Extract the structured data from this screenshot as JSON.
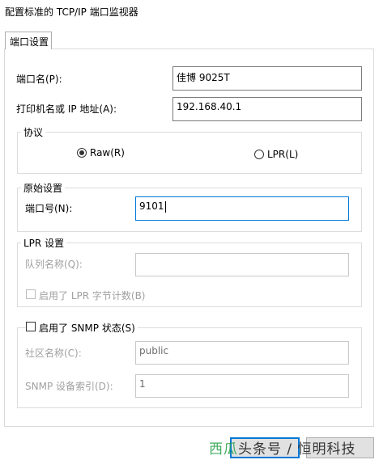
{
  "window": {
    "title": "配置标准的 TCP/IP 端口监视器"
  },
  "tabs": [
    {
      "label": "端口设置"
    }
  ],
  "fields": {
    "port_name": {
      "label": "端口名(P):",
      "value": "佳博 9025T"
    },
    "printer_address": {
      "label": "打印机名或 IP 地址(A):",
      "value": "192.168.40.1"
    }
  },
  "protocol": {
    "legend": "协议",
    "raw": {
      "label": "Raw(R)",
      "selected": true
    },
    "lpr": {
      "label": "LPR(L)",
      "selected": false
    }
  },
  "raw_settings": {
    "legend": "原始设置",
    "port_number": {
      "label": "端口号(N):",
      "value": "9101"
    }
  },
  "lpr_settings": {
    "legend": "LPR 设置",
    "queue_name": {
      "label": "队列名称(Q):",
      "value": ""
    },
    "byte_counting": {
      "label": "启用了 LPR 字节计数(B)",
      "checked": false
    }
  },
  "snmp": {
    "legend": "启用了 SNMP 状态(S)",
    "checked": false,
    "community": {
      "label": "社区名称(C):",
      "value": "public"
    },
    "device_index": {
      "label": "SNMP 设备索引(D):",
      "value": "1"
    }
  },
  "watermark": {
    "text_a": "西瓜",
    "text_b": "头条号 / 恒明科技"
  },
  "colors": {
    "focus_border": "#0078d7",
    "disabled_text": "#a0a0a0",
    "watermark": "#2ea44f"
  }
}
